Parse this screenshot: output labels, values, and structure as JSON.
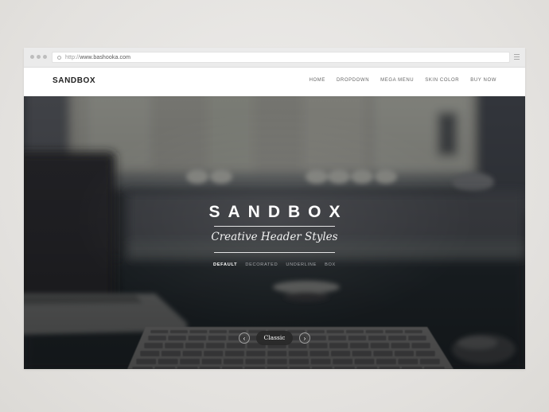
{
  "browser": {
    "url_protocol": "http://",
    "url_host": "www.bashooka.com",
    "icons": [
      "window-dots-icon",
      "reload-icon",
      "menu-icon"
    ]
  },
  "site": {
    "logo": "SANDBOX",
    "nav": [
      {
        "label": "HOME"
      },
      {
        "label": "DROPDOWN"
      },
      {
        "label": "MEGA MENU"
      },
      {
        "label": "SKIN COLOR"
      },
      {
        "label": "BUY NOW"
      }
    ]
  },
  "hero": {
    "title": "SANDBOX",
    "subtitle": "Creative Header Styles",
    "style_tabs": [
      {
        "label": "DEFAULT",
        "active": true
      },
      {
        "label": "DECORATED",
        "active": false
      },
      {
        "label": "UNDERLINE",
        "active": false
      },
      {
        "label": "BOX",
        "active": false
      }
    ],
    "slider": {
      "prev_icon": "‹",
      "next_icon": "›",
      "current_label": "Classic"
    },
    "background_description": "blurred grayscale desk photo: laptop, keyboard, mouse, window"
  },
  "colors": {
    "page_bg": "#e4e2df",
    "hero_dark": "#1e2125",
    "text_light": "#ffffff",
    "nav_text": "#666666"
  }
}
